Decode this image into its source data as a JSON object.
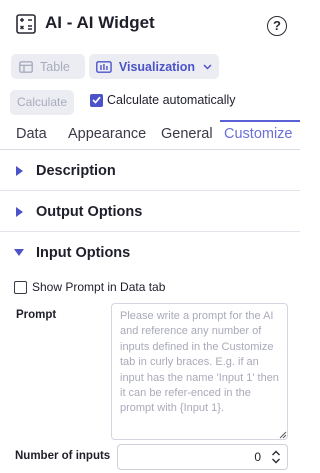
{
  "header": {
    "title": "AI - AI Widget",
    "help_label": "?"
  },
  "view_toggle": {
    "table_label": "Table",
    "visualization_label": "Visualization"
  },
  "calculate": {
    "button_label": "Calculate",
    "auto_label": "Calculate automatically",
    "auto_checked": true
  },
  "tabs": [
    {
      "label": "Data",
      "active": false
    },
    {
      "label": "Appearance",
      "active": false
    },
    {
      "label": "General",
      "active": false
    },
    {
      "label": "Customize",
      "active": true
    }
  ],
  "sections": [
    {
      "label": "Description",
      "expanded": false
    },
    {
      "label": "Output Options",
      "expanded": false
    },
    {
      "label": "Input Options",
      "expanded": true
    }
  ],
  "input_options": {
    "show_prompt_label": "Show Prompt in Data tab",
    "show_prompt_checked": false,
    "prompt_label": "Prompt",
    "prompt_placeholder": "Please write a prompt for the AI and reference any number of inputs defined in the Customize tab in curly braces. E.g. if an input has the name 'Input 1' then it can be refer-enced in the prompt with {Input 1}.",
    "num_inputs_label": "Number of inputs",
    "num_inputs_value": "0"
  },
  "colors": {
    "accent": "#4c53c9",
    "active_tab": "#6b6fd8",
    "muted": "#a9abbe"
  }
}
